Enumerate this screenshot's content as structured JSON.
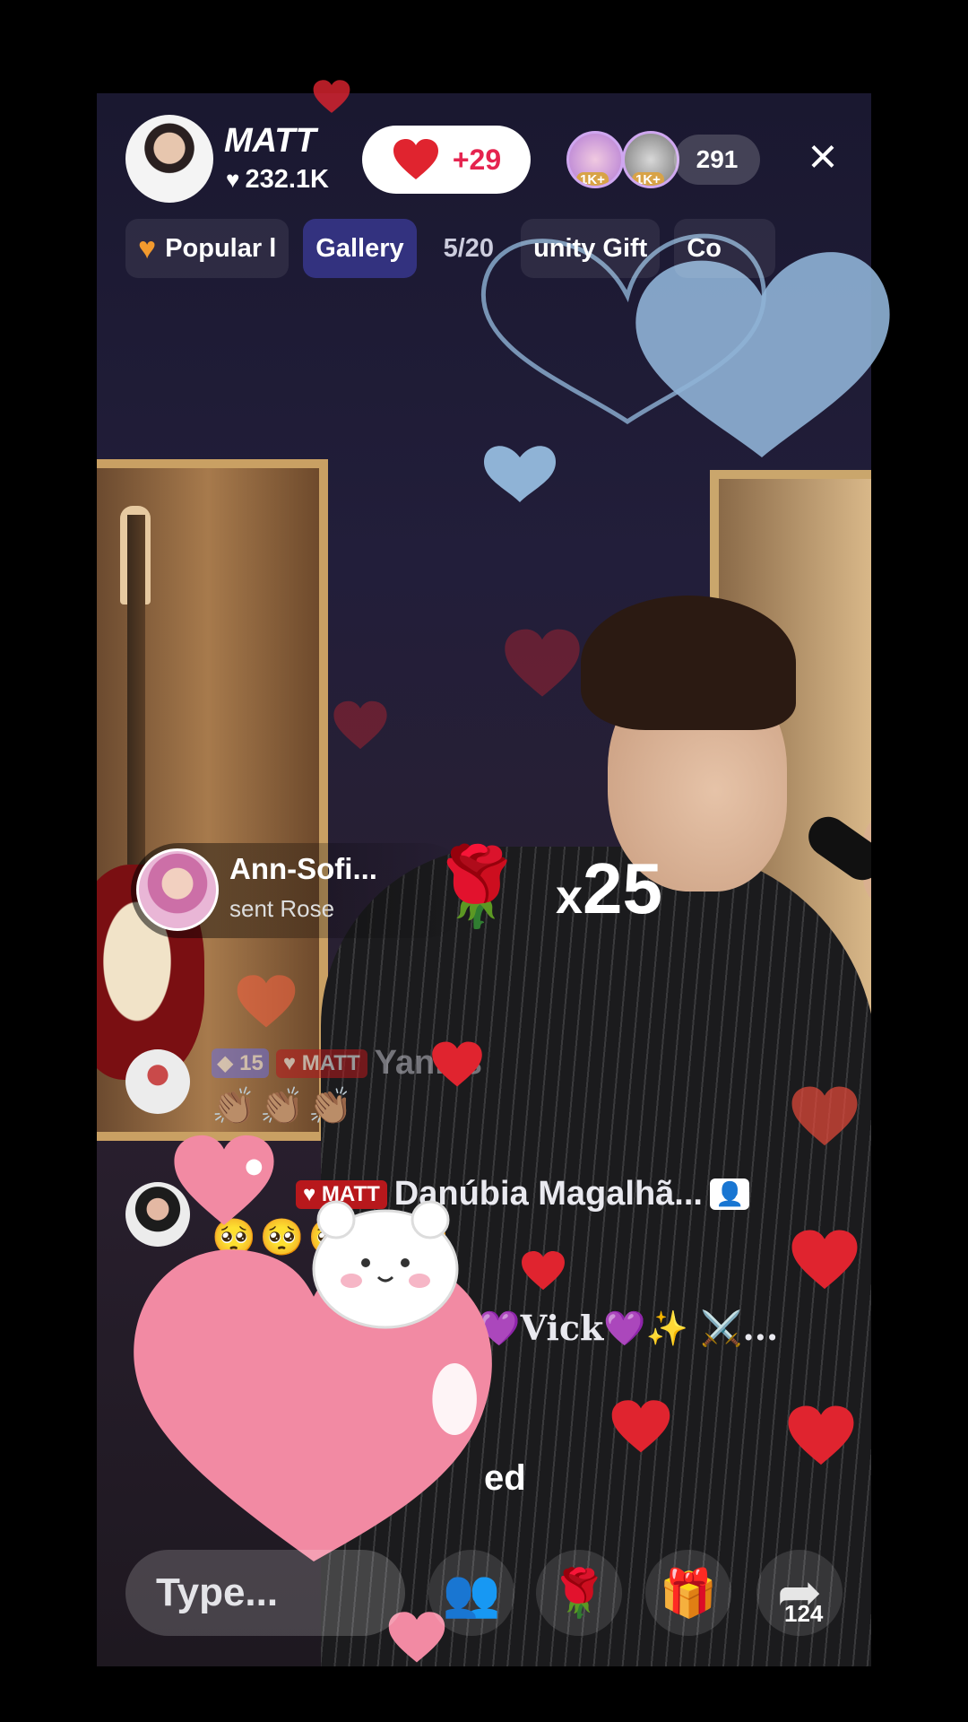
{
  "host": {
    "name": "MATT",
    "likes": "232.1K",
    "likes_delta": "+29"
  },
  "viewers": {
    "badges": [
      "1K+",
      "1K+"
    ],
    "count": "291"
  },
  "tabs": [
    {
      "label": "Popular l",
      "icon": "heart-icon"
    },
    {
      "label": "Gallery"
    },
    {
      "label": "5/20"
    },
    {
      "label": "unity Gift"
    },
    {
      "label": "Co"
    }
  ],
  "gift": {
    "sender": "Ann-Sofi...",
    "action": "sent Rose",
    "combo_prefix": "x",
    "combo_count": "25",
    "gift_icon": "rose-icon"
  },
  "chat": [
    {
      "level": "15",
      "club": "MATT",
      "name": "Yanilis",
      "message": "👏🏽👏🏽👏🏽"
    },
    {
      "club": "MATT",
      "name": "Danúbia Magalhã...",
      "message": "🥺🥺🥺🥺🥺"
    },
    {
      "name": "✨💜Vick💜✨ ⚔️..."
    }
  ],
  "joined_fragment": "ed",
  "input": {
    "placeholder": "Type..."
  },
  "actions": {
    "share_count": "124"
  },
  "colors": {
    "accent_red": "#e0242f",
    "heart_pink": "#f28aa3",
    "heart_blue": "#8fb3d6"
  }
}
